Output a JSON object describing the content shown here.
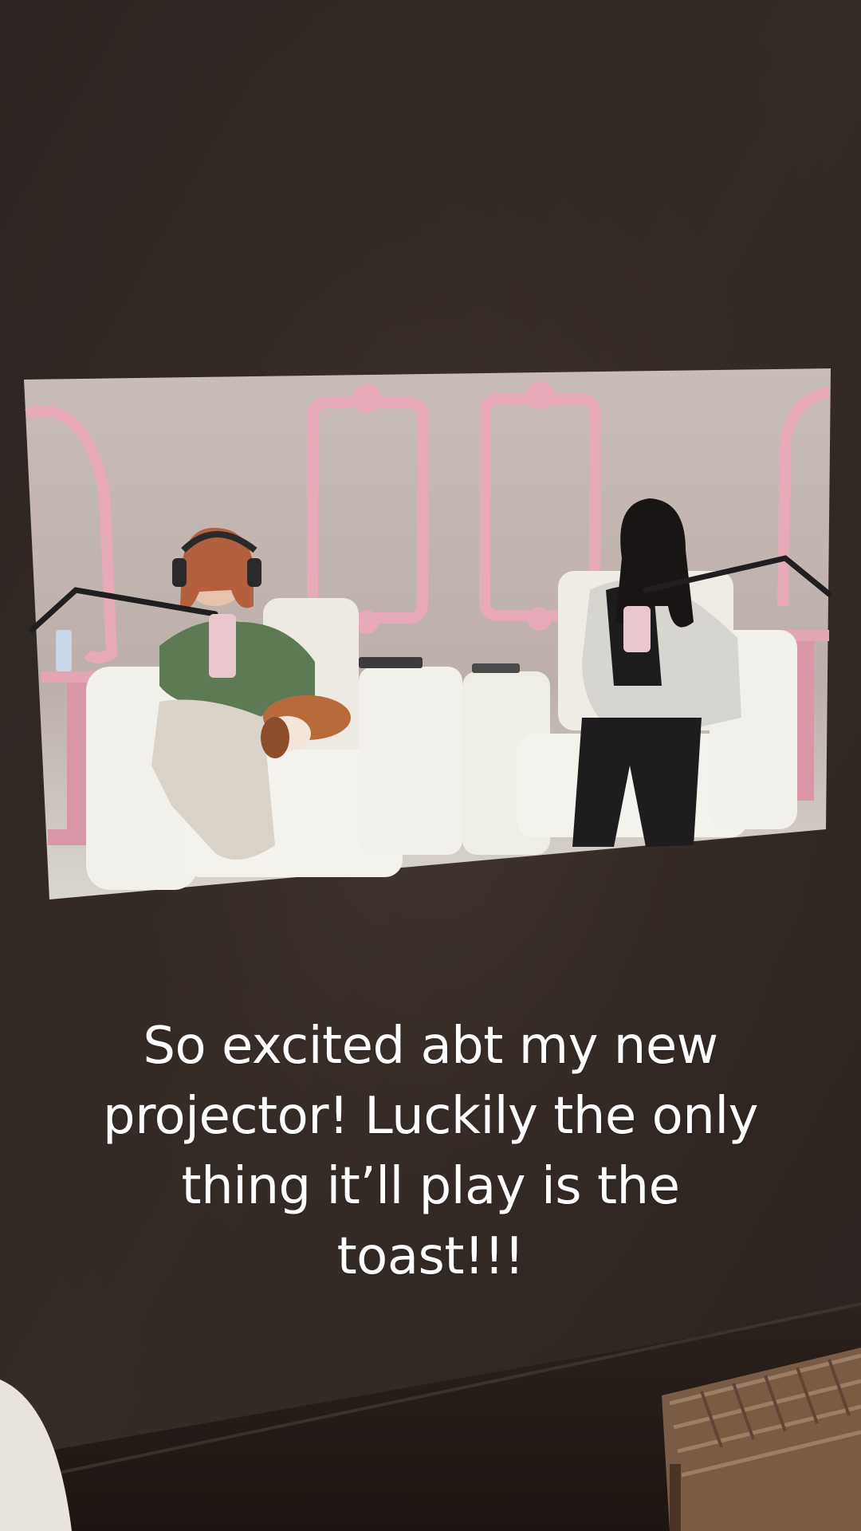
{
  "caption": {
    "line1": "So excited abt my new",
    "line2": "projector! Luckily the only",
    "line3": "thing it’ll play is the",
    "line4": "toast!!!"
  },
  "colors": {
    "wall": "#2f2722",
    "projection_bg": "#c8b8b4",
    "frame_pink": "#e8a9b9",
    "chair_white": "#f1f0ea",
    "caption_text": "#ffffff"
  }
}
